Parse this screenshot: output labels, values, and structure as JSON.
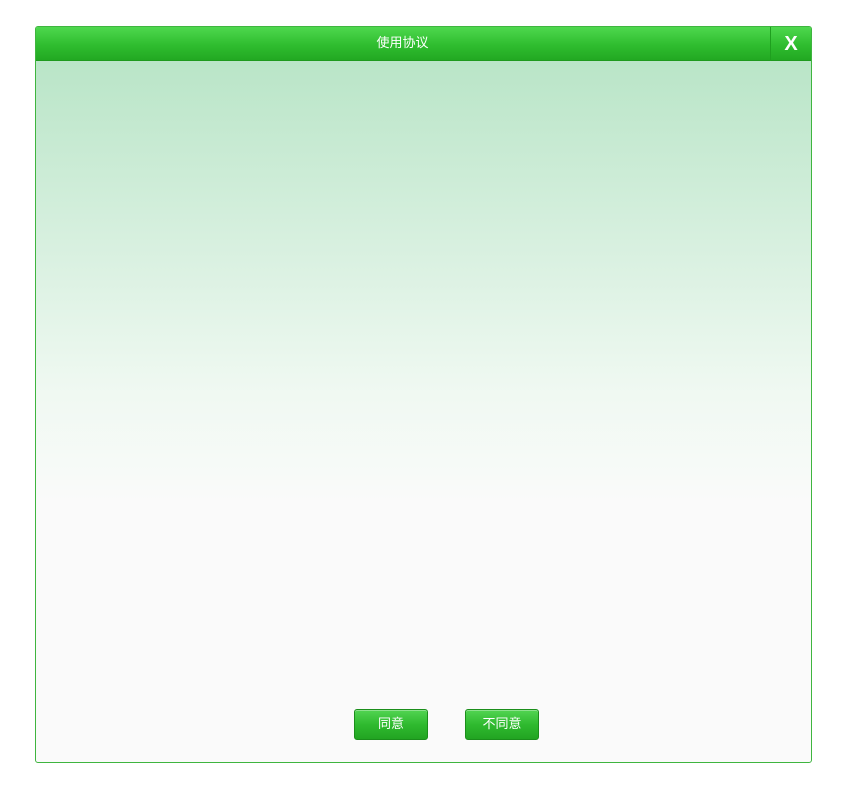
{
  "dialog": {
    "title": "使用协议",
    "close_label": "X",
    "agree_label": "同意",
    "disagree_label": "不同意"
  },
  "colors": {
    "accent": "#2fbd2f",
    "border": "#3fb53f",
    "content_top": "#b4e3c3",
    "content_bottom": "#fafafa"
  }
}
